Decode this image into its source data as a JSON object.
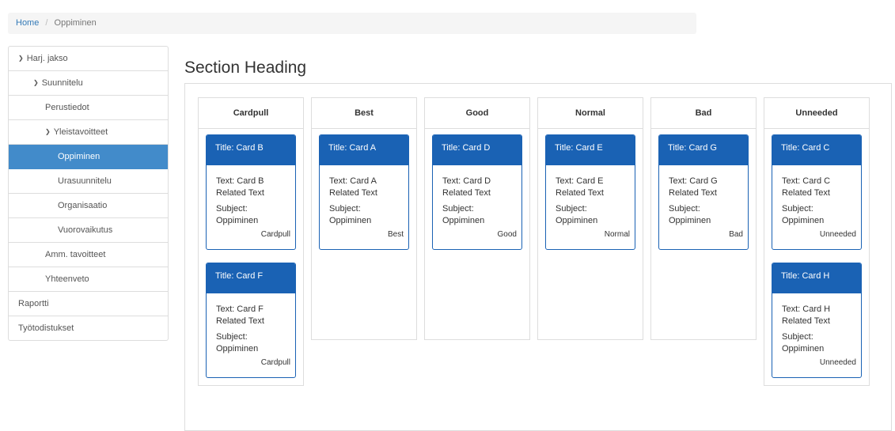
{
  "breadcrumb": {
    "home": "Home",
    "separator": "/",
    "current": "Oppiminen"
  },
  "sidebar": {
    "items": [
      {
        "label": "Harj. jakso",
        "chevron": "chevron-down-icon"
      },
      {
        "label": "Suunnitelu",
        "chevron": "chevron-down-icon"
      },
      {
        "label": "Perustiedot"
      },
      {
        "label": "Yleistavoitteet",
        "chevron": "chevron-down-icon"
      },
      {
        "label": "Oppiminen",
        "active": true
      },
      {
        "label": "Urasuunnitelu"
      },
      {
        "label": "Organisaatio"
      },
      {
        "label": "Vuorovaikutus"
      },
      {
        "label": "Amm. tavoitteet"
      },
      {
        "label": "Yhteenveto"
      },
      {
        "label": "Raportti"
      },
      {
        "label": "Työtodistukset"
      }
    ]
  },
  "main": {
    "heading": "Section Heading",
    "columns": [
      {
        "title": "Cardpull",
        "cards": [
          {
            "title": "Title: Card B",
            "text1": "Text: Card B",
            "text2": "Related Text",
            "subject1": "Subject:",
            "subject2": "Oppiminen",
            "footer": "Cardpull"
          },
          {
            "title": "Title: Card F",
            "text1": "Text: Card F",
            "text2": "Related Text",
            "subject1": "Subject:",
            "subject2": "Oppiminen",
            "footer": "Cardpull"
          }
        ]
      },
      {
        "title": "Best",
        "cards": [
          {
            "title": "Title: Card A",
            "text1": "Text: Card A",
            "text2": "Related Text",
            "subject1": "Subject:",
            "subject2": "Oppiminen",
            "footer": "Best"
          }
        ]
      },
      {
        "title": "Good",
        "cards": [
          {
            "title": "Title: Card D",
            "text1": "Text: Card D",
            "text2": "Related Text",
            "subject1": "Subject:",
            "subject2": "Oppiminen",
            "footer": "Good"
          }
        ]
      },
      {
        "title": "Normal",
        "cards": [
          {
            "title": "Title: Card E",
            "text1": "Text: Card E",
            "text2": "Related Text",
            "subject1": "Subject:",
            "subject2": "Oppiminen",
            "footer": "Normal"
          }
        ]
      },
      {
        "title": "Bad",
        "cards": [
          {
            "title": "Title: Card G",
            "text1": "Text: Card G",
            "text2": "Related Text",
            "subject1": "Subject:",
            "subject2": "Oppiminen",
            "footer": "Bad"
          }
        ]
      },
      {
        "title": "Unneeded",
        "cards": [
          {
            "title": "Title: Card C",
            "text1": "Text: Card C",
            "text2": "Related Text",
            "subject1": "Subject:",
            "subject2": "Oppiminen",
            "footer": "Unneeded"
          },
          {
            "title": "Title: Card H",
            "text1": "Text: Card H",
            "text2": "Related Text",
            "subject1": "Subject:",
            "subject2": "Oppiminen",
            "footer": "Unneeded"
          }
        ]
      }
    ]
  },
  "colors": {
    "accent": "#1a62b4",
    "active_nav": "#428bca",
    "link": "#337ab7"
  }
}
